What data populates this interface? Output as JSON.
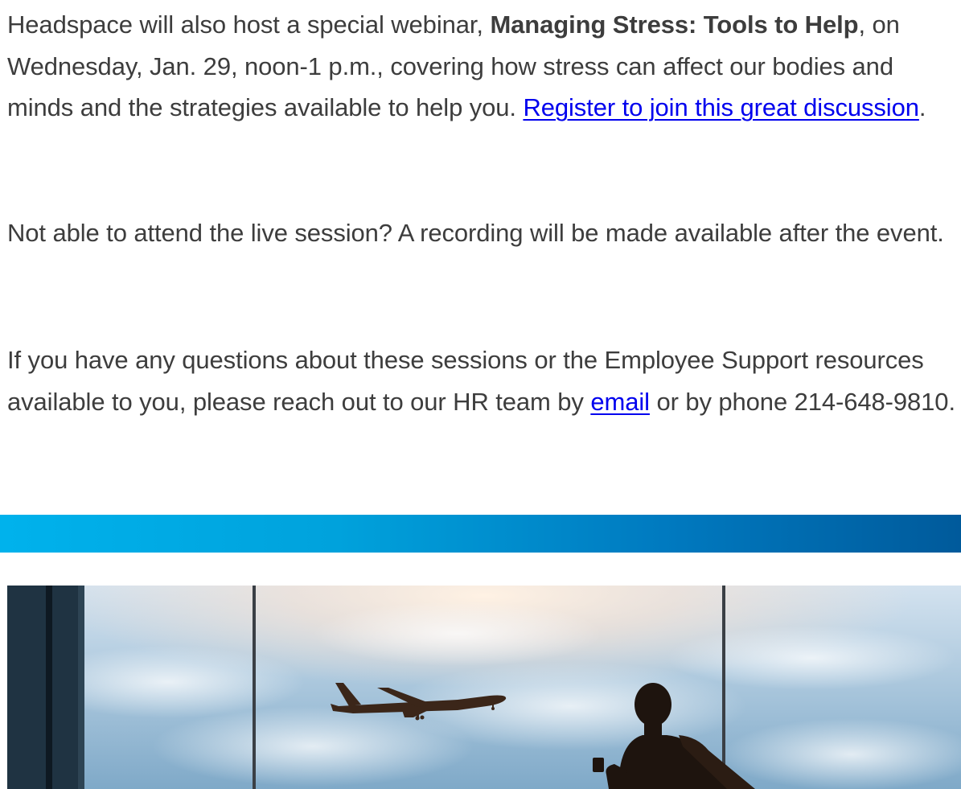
{
  "email": {
    "paragraph1": {
      "intro": "Headspace will also host a special webinar, ",
      "webinar_title": "Managing Stress: Tools to Help",
      "details": ", on Wednesday, Jan. 29, noon-1 p.m., covering how stress can affect our bodies and minds and the strategies available to help you. ",
      "register_link": "Register to join this great discussion",
      "end": "."
    },
    "paragraph2": {
      "text": "Not able to attend the live session? A recording will be made available after the event."
    },
    "paragraph3": {
      "intro": "If you have any questions about these sessions or the Employee Support resources available to you, please reach out to our HR team by ",
      "email_link": "email",
      "outro": " or by phone 214-648-9810."
    }
  },
  "colors": {
    "body_text": "#3d3d3d",
    "link": "#0000ee",
    "banner_gradient_start": "#00b2ec",
    "banner_gradient_end": "#005a9b"
  },
  "hero_image": {
    "subject": "silhouette of traveler watching airplane take off through airport window"
  }
}
